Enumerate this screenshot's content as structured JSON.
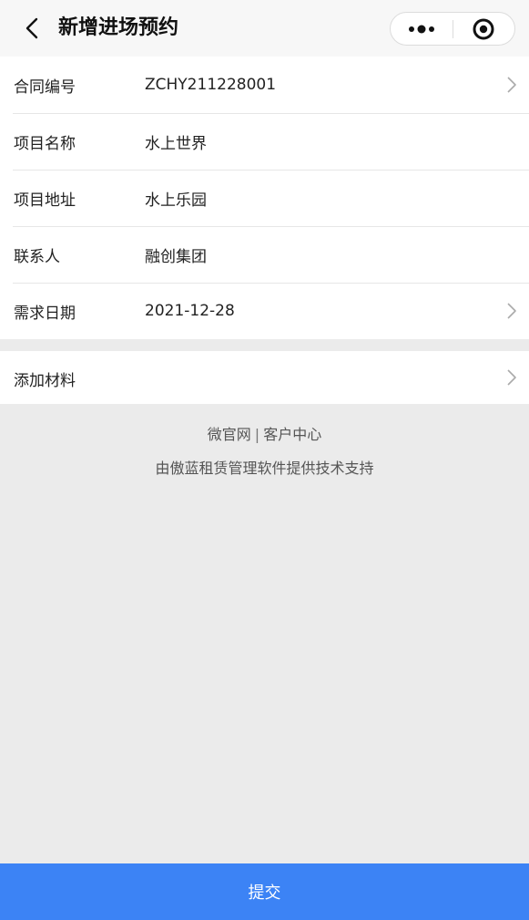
{
  "navbar": {
    "title": "新增进场预约",
    "back_icon": "chevron-left-icon",
    "capsule": {
      "more_icon": "more-dots-icon",
      "close_icon": "record-circle-icon"
    }
  },
  "form": {
    "rows": [
      {
        "label": "合同编号",
        "value": "ZCHY211228001",
        "has_arrow": true
      },
      {
        "label": "项目名称",
        "value": "水上世界",
        "has_arrow": false
      },
      {
        "label": "项目地址",
        "value": "水上乐园",
        "has_arrow": false
      },
      {
        "label": "联系人",
        "value": "融创集团",
        "has_arrow": false
      },
      {
        "label": "需求日期",
        "value": "2021-12-28",
        "has_arrow": true
      }
    ]
  },
  "materials": {
    "label": "添加材料",
    "has_arrow": true
  },
  "footer": {
    "link1": "微官网",
    "separator": "|",
    "link2": "客户中心",
    "support": "由傲蓝租赁管理软件提供技术支持"
  },
  "submit": {
    "label": "提交"
  },
  "colors": {
    "primary": "#3c83f5",
    "background": "#ebebeb",
    "navbar": "#f7f7f7"
  }
}
